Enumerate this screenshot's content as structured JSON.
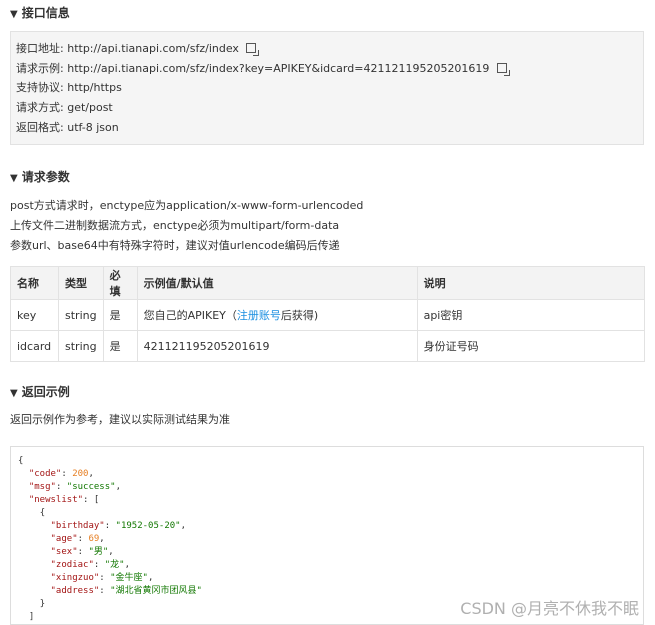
{
  "sections": {
    "interface": "接口信息",
    "params": "请求参数",
    "example": "返回示例"
  },
  "interface_info": {
    "address_label": "接口地址:",
    "address_value": "http://api.tianapi.com/sfz/index",
    "example_label": "请求示例:",
    "example_value": "http://api.tianapi.com/sfz/index?key=APIKEY&idcard=421121195205201619",
    "protocol_label": "支持协议:",
    "protocol_value": "http/https",
    "method_label": "请求方式:",
    "method_value": "get/post",
    "format_label": "返回格式:",
    "format_value": "utf-8 json"
  },
  "params_notes": [
    "post方式请求时，enctype应为application/x-www-form-urlencoded",
    "上传文件二进制数据流方式，enctype必须为multipart/form-data",
    "参数url、base64中有特殊字符时，建议对值urlencode编码后传递"
  ],
  "table": {
    "headers": [
      "名称",
      "类型",
      "必填",
      "示例值/默认值",
      "说明"
    ],
    "rows": [
      {
        "name": "key",
        "type": "string",
        "required": "是",
        "example_pre": "您自己的APIKEY（",
        "example_link": "注册账号",
        "example_post": "后获得)",
        "desc": "api密钥"
      },
      {
        "name": "idcard",
        "type": "string",
        "required": "是",
        "example_pre": "421121195205201619",
        "example_link": "",
        "example_post": "",
        "desc": "身份证号码"
      }
    ]
  },
  "example_note": "返回示例作为参考，建议以实际测试结果为准",
  "code": {
    "open": "{",
    "code_key": "\"code\"",
    "code_val": "200",
    "msg_key": "\"msg\"",
    "msg_val": "\"success\"",
    "newslist_key": "\"newslist\"",
    "arr_open": "[",
    "obj_open": "{",
    "birthday_key": "\"birthday\"",
    "birthday_val": "\"1952-05-20\"",
    "age_key": "\"age\"",
    "age_val": "69",
    "sex_key": "\"sex\"",
    "sex_val": "\"男\"",
    "zodiac_key": "\"zodiac\"",
    "zodiac_val": "\"龙\"",
    "xingzuo_key": "\"xingzuo\"",
    "xingzuo_val": "\"金牛座\"",
    "address_key": "\"address\"",
    "address_val": "\"湖北省黄冈市团风县\"",
    "obj_close": "}",
    "arr_close": "]"
  },
  "watermark": "CSDN @月亮不休我不眠"
}
